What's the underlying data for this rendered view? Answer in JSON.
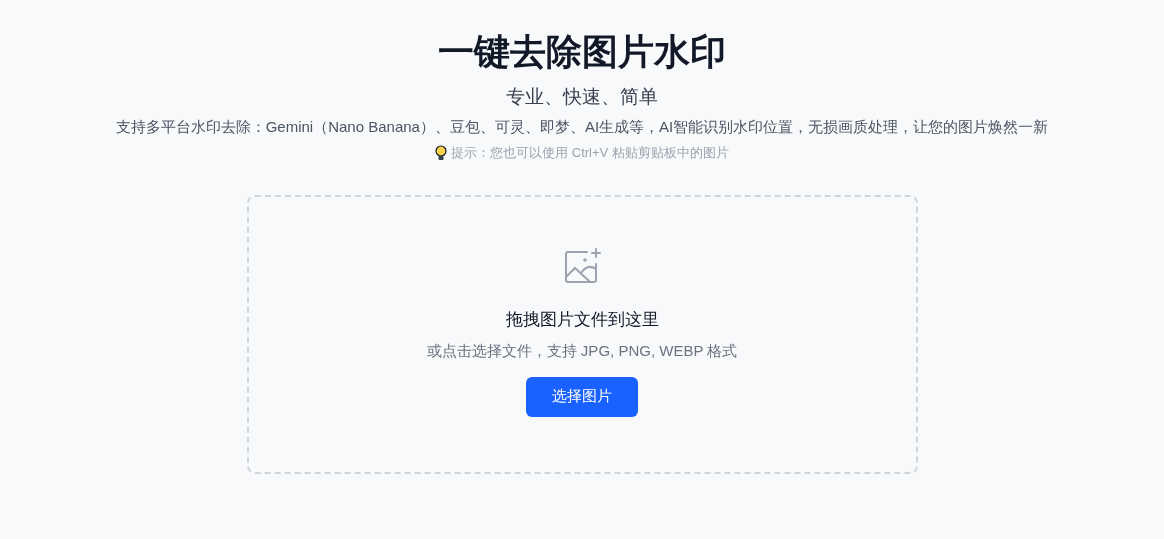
{
  "title": "一键去除图片水印",
  "subtitle": "专业、快速、简单",
  "description": "支持多平台水印去除：Gemini（Nano Banana）、豆包、可灵、即梦、AI生成等，AI智能识别水印位置，无损画质处理，让您的图片焕然一新",
  "tip": "提示：您也可以使用 Ctrl+V 粘贴剪贴板中的图片",
  "dropzone": {
    "heading": "拖拽图片文件到这里",
    "hint": "或点击选择文件，支持 JPG, PNG, WEBP 格式",
    "button": "选择图片"
  }
}
